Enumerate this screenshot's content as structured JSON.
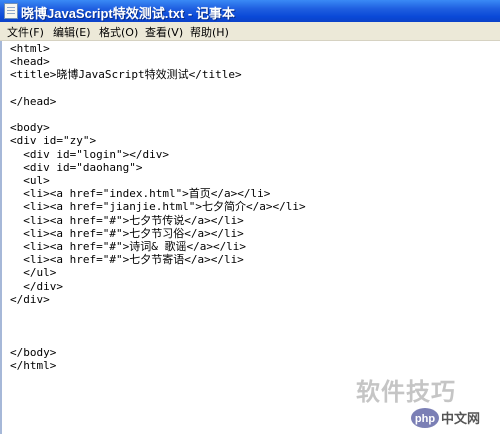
{
  "window": {
    "title": "晓博JavaScript特效测试.txt - 记事本"
  },
  "menu": {
    "items": [
      "文件(F)",
      "编辑(E)",
      "格式(O)",
      "查看(V)",
      "帮助(H)"
    ]
  },
  "document": {
    "lines": [
      "<html>",
      "<head>",
      "<title>晓博JavaScript特效测试</title>",
      "",
      "</head>",
      "",
      "<body>",
      "<div id=\"zy\">",
      "  <div id=\"login\"></div>",
      "  <div id=\"daohang\">",
      "  <ul>",
      "  <li><a href=\"index.html\">首页</a></li>",
      "  <li><a href=\"jianjie.html\">七夕简介</a></li>",
      "  <li><a href=\"#\">七夕节传说</a></li>",
      "  <li><a href=\"#\">七夕节习俗</a></li>",
      "  <li><a href=\"#\">诗词& 歌谣</a></li>",
      "  <li><a href=\"#\">七夕节寄语</a></li>",
      "  </ul>",
      "  </div>",
      "</div>",
      "",
      "",
      "",
      "</body>",
      "</html>"
    ]
  },
  "watermark": {
    "text": "软件技巧",
    "logo_text": "php中文网"
  }
}
